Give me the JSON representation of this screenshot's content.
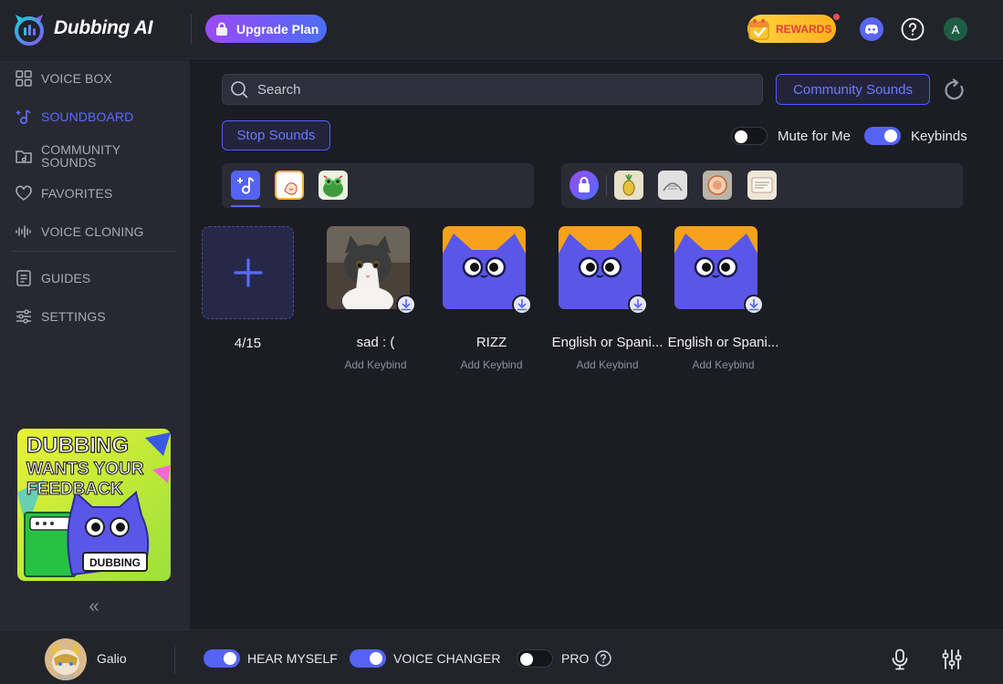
{
  "app": {
    "brand": "Dubbing AI"
  },
  "header": {
    "upgrade_label": "Upgrade Plan",
    "rewards_label": "REWARDS",
    "avatar_initial": "A"
  },
  "sidebar": {
    "items": [
      {
        "label": "VOICE BOX",
        "icon": "grid-icon"
      },
      {
        "label": "SOUNDBOARD",
        "icon": "music-note-plus-icon",
        "active": true
      },
      {
        "label": "COMMUNITY SOUNDS",
        "icon": "folder-music-icon"
      },
      {
        "label": "FAVORITES",
        "icon": "heart-icon"
      },
      {
        "label": "VOICE CLONING",
        "icon": "waveform-icon"
      },
      {
        "label": "GUIDES",
        "icon": "document-icon"
      },
      {
        "label": "SETTINGS",
        "icon": "sliders-icon"
      }
    ],
    "banner": {
      "line1": "DUBBING",
      "line2": "WANTS YOUR",
      "line3": "FEEDBACK",
      "badge": "DUBBING"
    },
    "collapse_glyph": "«"
  },
  "main": {
    "search_placeholder": "Search",
    "community_label": "Community Sounds",
    "stop_label": "Stop Sounds",
    "mute_label": "Mute for Me",
    "mute_on": false,
    "keybinds_label": "Keybinds",
    "keybinds_on": true,
    "count_label": "4/15",
    "sounds": [
      {
        "name": "sad : (",
        "keybind": "Add Keybind",
        "thumb": "cat-photo"
      },
      {
        "name": "RIZZ",
        "keybind": "Add Keybind",
        "thumb": "dubbing-mascot"
      },
      {
        "name": "English or Spani...",
        "keybind": "Add Keybind",
        "thumb": "dubbing-mascot"
      },
      {
        "name": "English or Spani...",
        "keybind": "Add Keybind",
        "thumb": "dubbing-mascot"
      }
    ]
  },
  "bottombar": {
    "user_name": "Galio",
    "hear_label": "HEAR MYSELF",
    "hear_on": true,
    "changer_label": "VOICE CHANGER",
    "changer_on": true,
    "pro_label": "PRO",
    "pro_on": false
  },
  "colors": {
    "accent": "#5563f5",
    "background": "#1c1c24",
    "sidebar": "#272832",
    "mascot_orange": "#f7a21b",
    "mascot_blue": "#5a57e8"
  }
}
